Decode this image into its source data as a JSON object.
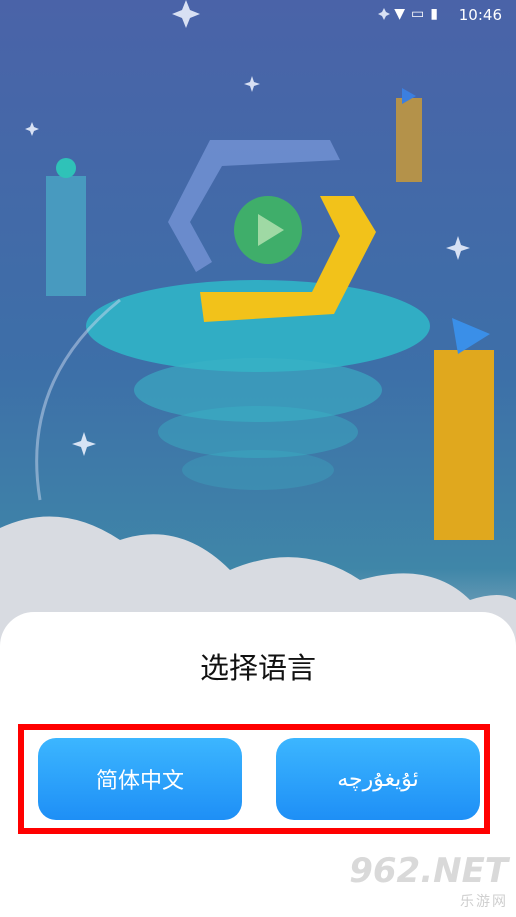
{
  "status_bar": {
    "time": "10:46",
    "icons": [
      "wifi-icon",
      "no-sim-icon",
      "battery-icon"
    ]
  },
  "dialog": {
    "title": "选择语言",
    "options": [
      {
        "label": "简体中文"
      },
      {
        "label": "ئۇيغۇرچە"
      }
    ]
  },
  "watermark": {
    "brand": "962.NET",
    "sub": "乐游网"
  },
  "colors": {
    "button_top": "#3cb6ff",
    "button_bottom": "#1e8ff6",
    "highlight": "#ff0000"
  }
}
